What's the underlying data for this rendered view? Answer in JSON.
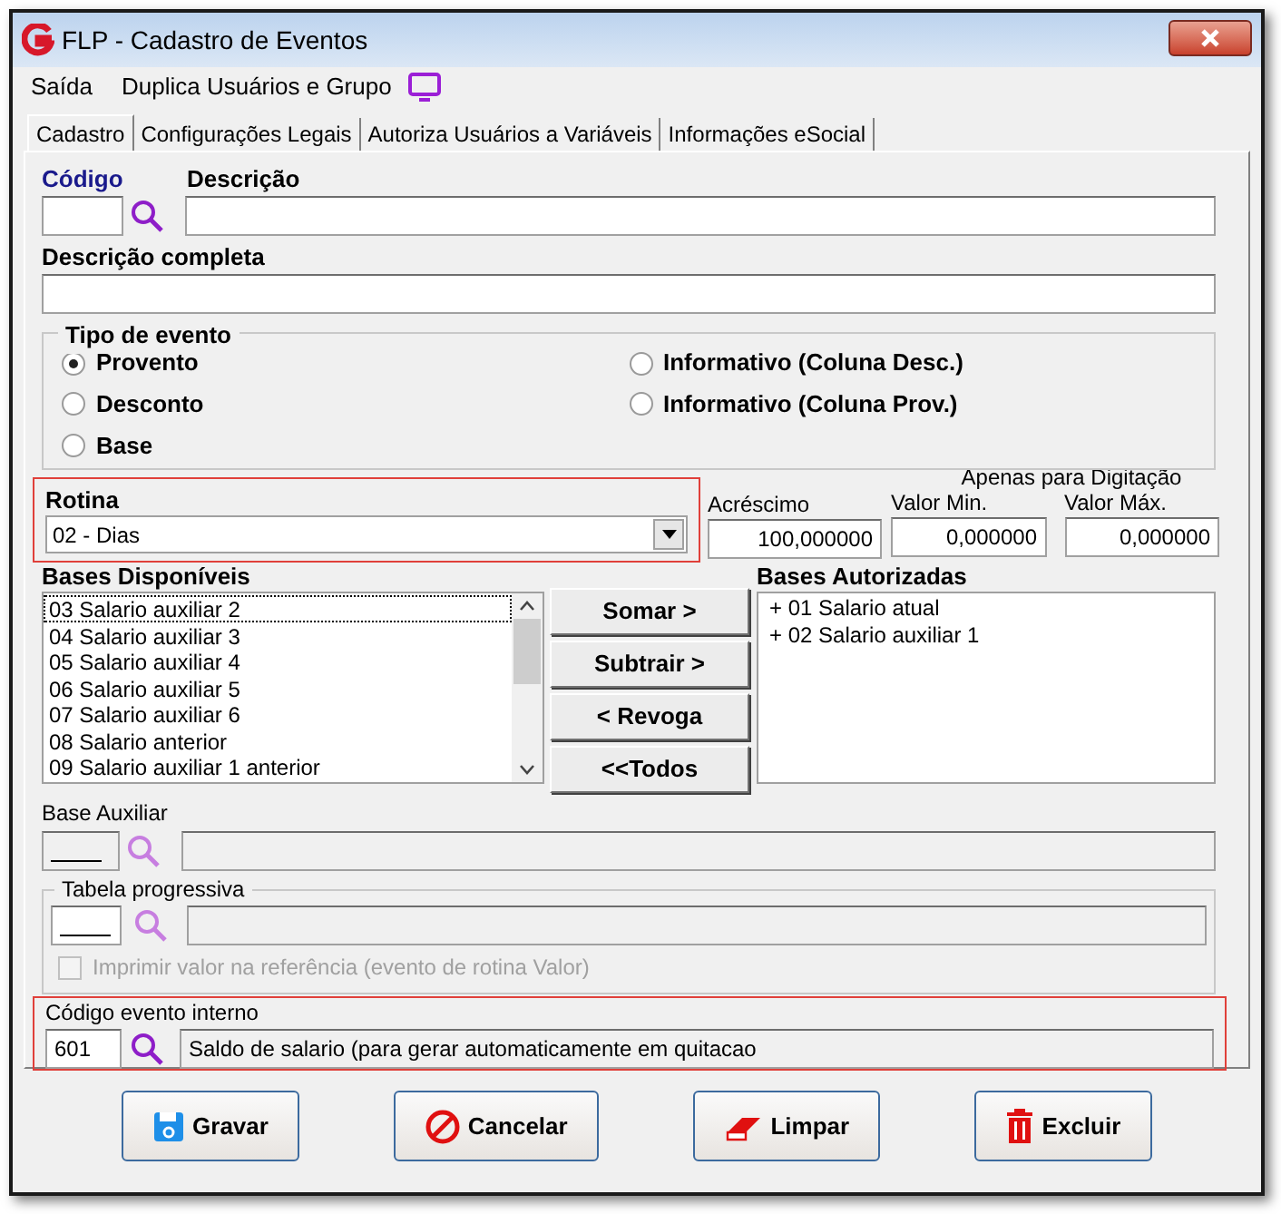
{
  "window": {
    "title": "FLP - Cadastro de Eventos"
  },
  "menu": [
    {
      "label": "Saída"
    },
    {
      "label": "Duplica Usuários e Grupo"
    }
  ],
  "tabs": [
    {
      "label": "Cadastro",
      "selected": true
    },
    {
      "label": "Configurações Legais",
      "selected": false
    },
    {
      "label": "Autoriza Usuários a Variáveis",
      "selected": false
    },
    {
      "label": "Informações eSocial",
      "selected": false
    }
  ],
  "codigo": {
    "label": "Código"
  },
  "descricao": {
    "label": "Descrição"
  },
  "descricao_completa": {
    "label": "Descrição completa"
  },
  "tipo_evento": {
    "title": "Tipo de evento",
    "options": [
      {
        "label": "Provento",
        "selected": true
      },
      {
        "label": "Desconto",
        "selected": false
      },
      {
        "label": "Base",
        "selected": false
      },
      {
        "label": "Informativo (Coluna Desc.)",
        "selected": false
      },
      {
        "label": "Informativo (Coluna Prov.)",
        "selected": false
      }
    ]
  },
  "rotina": {
    "label": "Rotina",
    "value": "02 - Dias",
    "highlighted": true
  },
  "acrescimo": {
    "label": "Acréscimo",
    "value": "100,000000"
  },
  "apenas_para_digitacao": {
    "title": "Apenas para Digitação",
    "fields": [
      {
        "label": "Valor Min.",
        "value": "0,000000"
      },
      {
        "label": "Valor Máx.",
        "value": "0,000000"
      }
    ]
  },
  "bases_disponiveis": {
    "title": "Bases Disponíveis",
    "items": [
      {
        "label": "03 Salario auxiliar 2",
        "selected": true
      },
      {
        "label": "04 Salario auxiliar 3",
        "selected": false
      },
      {
        "label": "05 Salario auxiliar 4",
        "selected": false
      },
      {
        "label": "06 Salario auxiliar 5",
        "selected": false
      },
      {
        "label": "07 Salario auxiliar 6",
        "selected": false
      },
      {
        "label": "08 Salario anterior",
        "selected": false
      },
      {
        "label": "09 Salario auxiliar 1 anterior",
        "selected": false
      }
    ]
  },
  "transfer_buttons": [
    {
      "label": "Somar >"
    },
    {
      "label": "Subtrair >"
    },
    {
      "label": "< Revoga"
    },
    {
      "label": "<<Todos"
    }
  ],
  "bases_autorizadas": {
    "title": "Bases Autorizadas",
    "items": [
      {
        "label": "+ 01 Salario atual"
      },
      {
        "label": "+ 02 Salario auxiliar 1"
      }
    ]
  },
  "base_auxiliar": {
    "label": "Base Auxiliar",
    "disabled": true
  },
  "tabela_progressiva": {
    "title": "Tabela progressiva",
    "checkbox": {
      "label": "Imprimir valor na referência (evento de rotina Valor)",
      "checked": false,
      "disabled": true
    }
  },
  "codigo_evento_interno": {
    "label": "Código evento interno",
    "code": "601",
    "description": "Saldo de salario (para gerar automaticamente em quitacao",
    "highlighted": true
  },
  "buttons": [
    {
      "label": "Gravar",
      "kind": "save"
    },
    {
      "label": "Cancelar",
      "kind": "cancel"
    },
    {
      "label": "Limpar",
      "kind": "clear"
    },
    {
      "label": "Excluir",
      "kind": "delete"
    }
  ]
}
